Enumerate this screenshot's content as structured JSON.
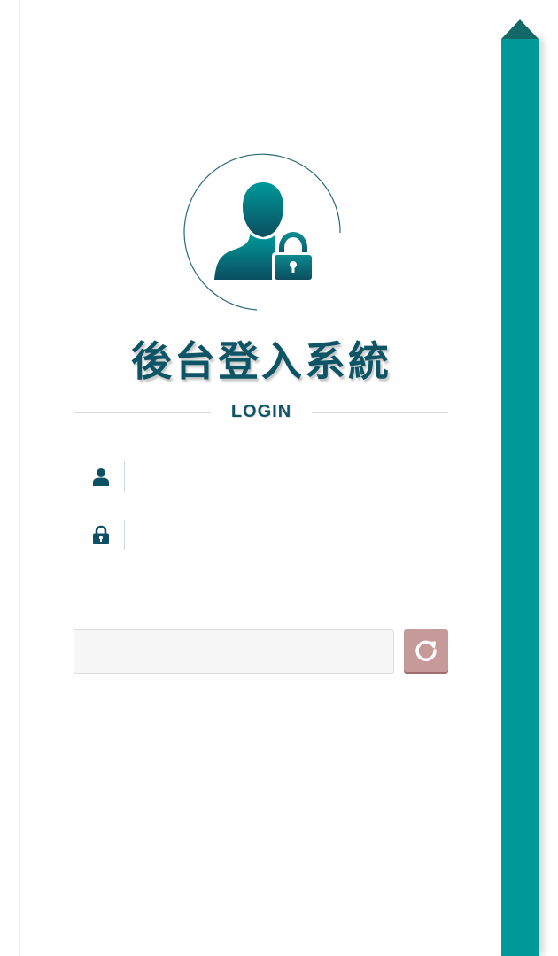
{
  "login": {
    "title": "後台登入系統",
    "divider_label": "LOGIN",
    "username": {
      "value": "",
      "placeholder": ""
    },
    "password": {
      "value": "",
      "placeholder": ""
    },
    "captcha": {
      "value": "",
      "placeholder": ""
    }
  },
  "icons": {
    "avatar": "user-lock-icon",
    "username": "user-icon",
    "password": "lock-icon",
    "refresh": "refresh-icon"
  },
  "colors": {
    "accent": "#00999a",
    "accent_dark": "#116866",
    "title": "#0d5566",
    "refresh_button": "#c79a9a"
  }
}
